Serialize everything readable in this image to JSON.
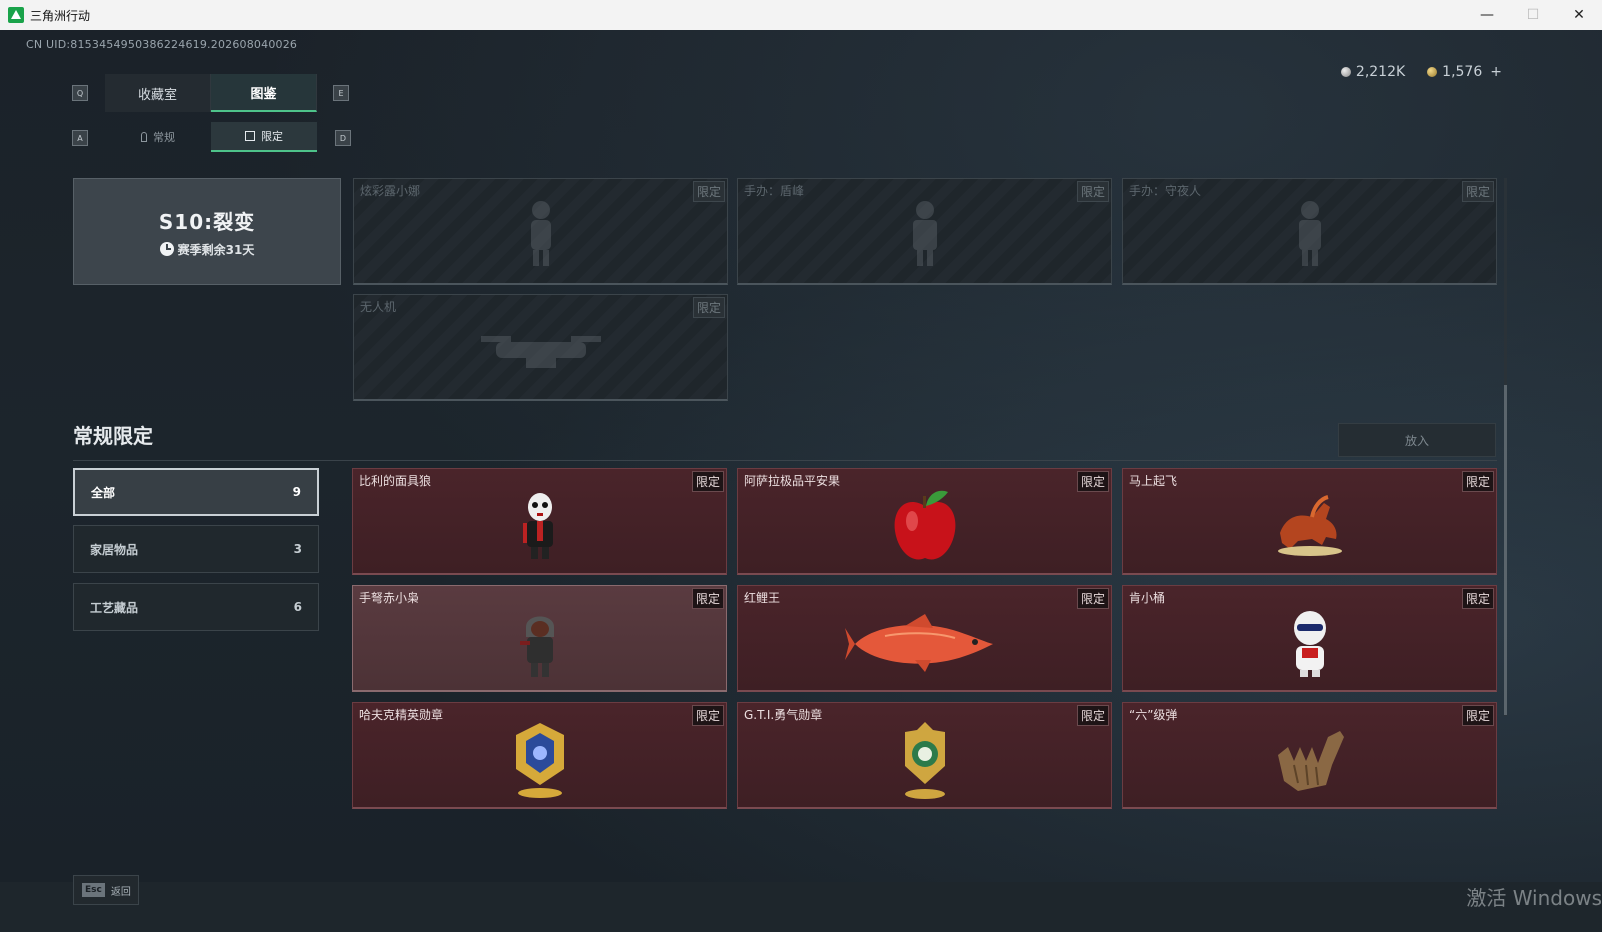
{
  "window": {
    "title": "三角洲行动",
    "controls": {
      "minimize": "—",
      "maximize": "☐",
      "close": "✕"
    }
  },
  "uid_text": "CN UID:8153454950386224619.202608040026",
  "currency": {
    "silver": "2,212K",
    "gold": "1,576",
    "add": "+"
  },
  "tabs": {
    "left_key": "Q",
    "right_key": "E",
    "items": [
      {
        "label": "收藏室",
        "active": false
      },
      {
        "label": "图鉴",
        "active": true
      }
    ]
  },
  "subtabs": {
    "left_key": "A",
    "right_key": "D",
    "items": [
      {
        "label": "常规",
        "icon": "hand-icon",
        "active": false
      },
      {
        "label": "限定",
        "icon": "image-icon",
        "active": true
      }
    ]
  },
  "season": {
    "title": "S10:裂变",
    "remaining": "赛季剩余31天"
  },
  "season_cards": [
    {
      "name": "炫彩露小娜",
      "tag": "限定"
    },
    {
      "name": "手办：盾峰",
      "tag": "限定"
    },
    {
      "name": "手办：守夜人",
      "tag": "限定"
    },
    {
      "name": "无人机",
      "tag": "限定"
    }
  ],
  "section": {
    "title": "常规限定",
    "place_button": "放入"
  },
  "filters": [
    {
      "label": "全部",
      "count": "9",
      "active": true
    },
    {
      "label": "家居物品",
      "count": "3",
      "active": false
    },
    {
      "label": "工艺藏品",
      "count": "6",
      "active": false
    }
  ],
  "items": [
    {
      "name": "比利的面具狼",
      "tag": "限定",
      "icon": "mask-figure-icon"
    },
    {
      "name": "阿萨拉极品平安果",
      "tag": "限定",
      "icon": "apple-icon"
    },
    {
      "name": "马上起飞",
      "tag": "限定",
      "icon": "horse-sculpture-icon"
    },
    {
      "name": "手弩赤小枭",
      "tag": "限定",
      "icon": "hooded-figure-icon"
    },
    {
      "name": "红鲤王",
      "tag": "限定",
      "icon": "carp-fish-icon"
    },
    {
      "name": "肯小桶",
      "tag": "限定",
      "icon": "chibi-figure-icon"
    },
    {
      "name": "哈夫克精英勋章",
      "tag": "限定",
      "icon": "medal-icon"
    },
    {
      "name": "G.T.I.勇气勋章",
      "tag": "限定",
      "icon": "courage-medal-icon"
    },
    {
      "name": "“六”级弹",
      "tag": "限定",
      "icon": "glove-hand-icon"
    }
  ],
  "footer": {
    "esc_key": "Esc",
    "back_label": "返回",
    "watermark": "激活 Windows"
  },
  "colors": {
    "accent": "#4ec38a",
    "owned_card": "#4a242a",
    "locked_card": "#1f262b"
  }
}
